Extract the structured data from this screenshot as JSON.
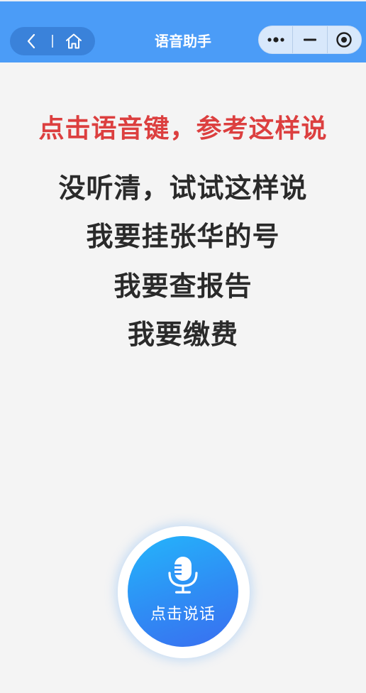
{
  "nav": {
    "title": "语音助手",
    "back_icon": "chevron-left-icon",
    "home_icon": "home-icon",
    "more_icon": "more-dots-icon",
    "minimize_icon": "minimize-icon",
    "close_icon": "target-circle-icon",
    "bar_color": "#4b9cf7"
  },
  "main": {
    "hint": "点击语音键，参考这样说",
    "hint_color": "#dc3f3f",
    "lines": [
      "没听清，试试这样说",
      "我要挂张华的号",
      "我要查报告",
      "我要缴费"
    ]
  },
  "mic_button": {
    "label": "点击说话",
    "icon": "microphone-icon",
    "gradient": [
      "#24b5fb",
      "#3a6ef0"
    ]
  }
}
